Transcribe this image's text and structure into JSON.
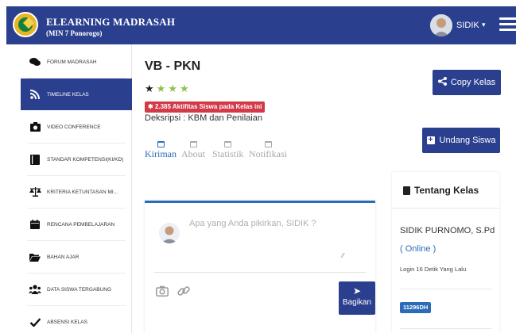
{
  "header": {
    "brand_title": "ELEARNING MADRASAH",
    "brand_subtitle": "(MIN 7 Ponorogo)",
    "user_name": "SIDIK",
    "color": "#2b3f8f"
  },
  "sidebar": {
    "items": [
      {
        "label": "FORUM MADRASAH",
        "icon": "comments-icon"
      },
      {
        "label": "TIMELINE KELAS",
        "icon": "rss-icon",
        "active": true
      },
      {
        "label": "VIDEO CONFERENCE",
        "icon": "camera-icon"
      },
      {
        "label": "STANDAR KOMPETENSI(KI/KD)",
        "icon": "book-icon"
      },
      {
        "label": "KRITERIA KETUNTASAN MI...",
        "icon": "balance-scale-icon"
      },
      {
        "label": "RENCANA PEMBELAJARAN",
        "icon": "calendar-icon"
      },
      {
        "label": "BAHAN AJAR",
        "icon": "folder-open-icon"
      },
      {
        "label": "DATA SISWA TERGABUNG",
        "icon": "users-icon"
      },
      {
        "label": "ABSENSI KELAS",
        "icon": "check-icon"
      }
    ]
  },
  "class": {
    "title": "VB - PKN",
    "rating": {
      "filled": 1,
      "total": 4
    },
    "activity_badge": "2.385 Aktifitas Siswa pada Kelas ini",
    "description": "Deksripsi : KBM dan Penilaian"
  },
  "tabs": [
    {
      "label": "Kiriman",
      "active": true
    },
    {
      "label": "About"
    },
    {
      "label": "Statistik"
    },
    {
      "label": "Notifikasi"
    }
  ],
  "buttons": {
    "copy_label": "Copy Kelas",
    "invite_label": "Undang Siswa",
    "share_label": "Bagikan"
  },
  "composer": {
    "placeholder": "Apa yang Anda pikirkan, SIDIK ?"
  },
  "about": {
    "title": "Tentang Kelas",
    "teacher": "SIDIK PURNOMO, S.Pd",
    "status": "( Online )",
    "last_login": "Login 16 Detik Yang Lalu",
    "class_code": "11296DH"
  },
  "colors": {
    "primary": "#2b3f8f",
    "accent_blue": "#2b6cb8",
    "badge_red": "#d33a47",
    "star_green": "#8bc34a"
  }
}
